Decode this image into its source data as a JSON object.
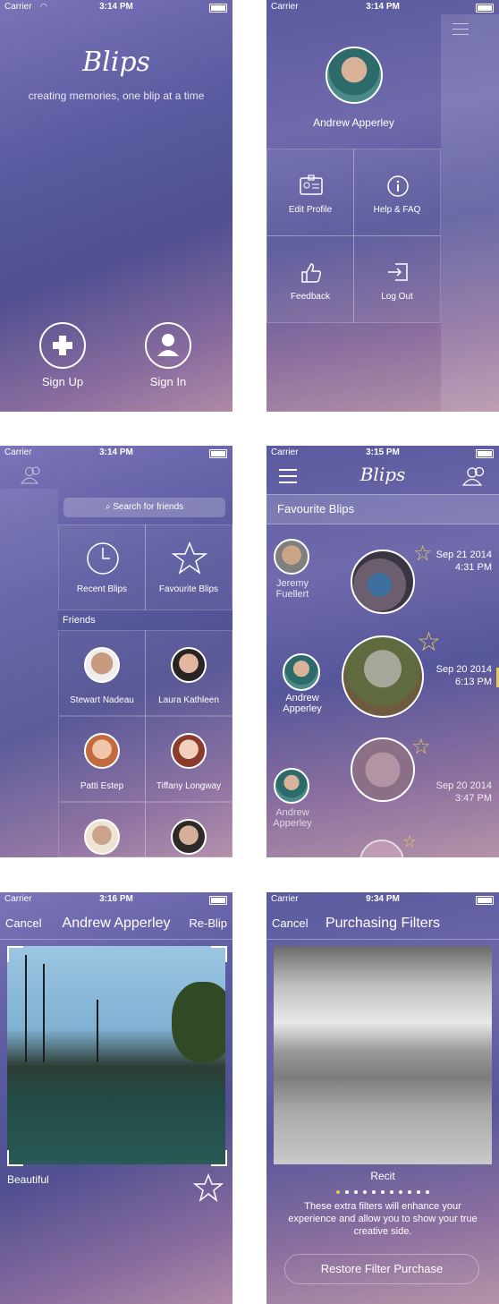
{
  "status": {
    "carrier": "Carrier",
    "times": [
      "3:14 PM",
      "3:14 PM",
      "3:14 PM",
      "3:15 PM",
      "3:16 PM",
      "9:34 PM"
    ]
  },
  "welcome": {
    "title": "Blips",
    "subtitle": "creating memories, one blip at a time",
    "signup_label": "Sign Up",
    "signin_label": "Sign In"
  },
  "menu": {
    "user_name": "Andrew Apperley",
    "items": [
      {
        "label": "Edit Profile",
        "icon": "id-card-icon"
      },
      {
        "label": "Help & FAQ",
        "icon": "info-icon"
      },
      {
        "label": "Feedback",
        "icon": "thumbs-up-icon"
      },
      {
        "label": "Log Out",
        "icon": "logout-icon"
      }
    ]
  },
  "friends": {
    "search_placeholder": "Search for friends",
    "recent_label": "Recent Blips",
    "favourite_label": "Favourite Blips",
    "section_title": "Friends",
    "list": [
      "Stewart Nadeau",
      "Laura Kathleen",
      "Patti Estep",
      "Tiffany Longway"
    ]
  },
  "favourites": {
    "title": "Blips",
    "section_title": "Favourite Blips",
    "entries": [
      {
        "user": "Jeremy Fuellert",
        "date": "Sep 21 2014",
        "time": "4:31 PM"
      },
      {
        "user": "Andrew Apperley",
        "date": "Sep 20 2014",
        "time": "6:13 PM"
      },
      {
        "user": "Andrew Apperley",
        "date": "Sep 20 2014",
        "time": "3:47 PM"
      }
    ]
  },
  "reblip": {
    "cancel": "Cancel",
    "title": "Andrew Apperley",
    "action": "Re-Blip",
    "caption": "Beautiful"
  },
  "filters": {
    "cancel": "Cancel",
    "title": "Purchasing Filters",
    "filter_name": "Recit",
    "description": "These extra filters will enhance your experience and allow you to show your true creative side.",
    "restore_label": "Restore Filter Purchase",
    "page_count": 11,
    "active_page": 0
  },
  "colors": {
    "accent": "#e7c65a"
  }
}
